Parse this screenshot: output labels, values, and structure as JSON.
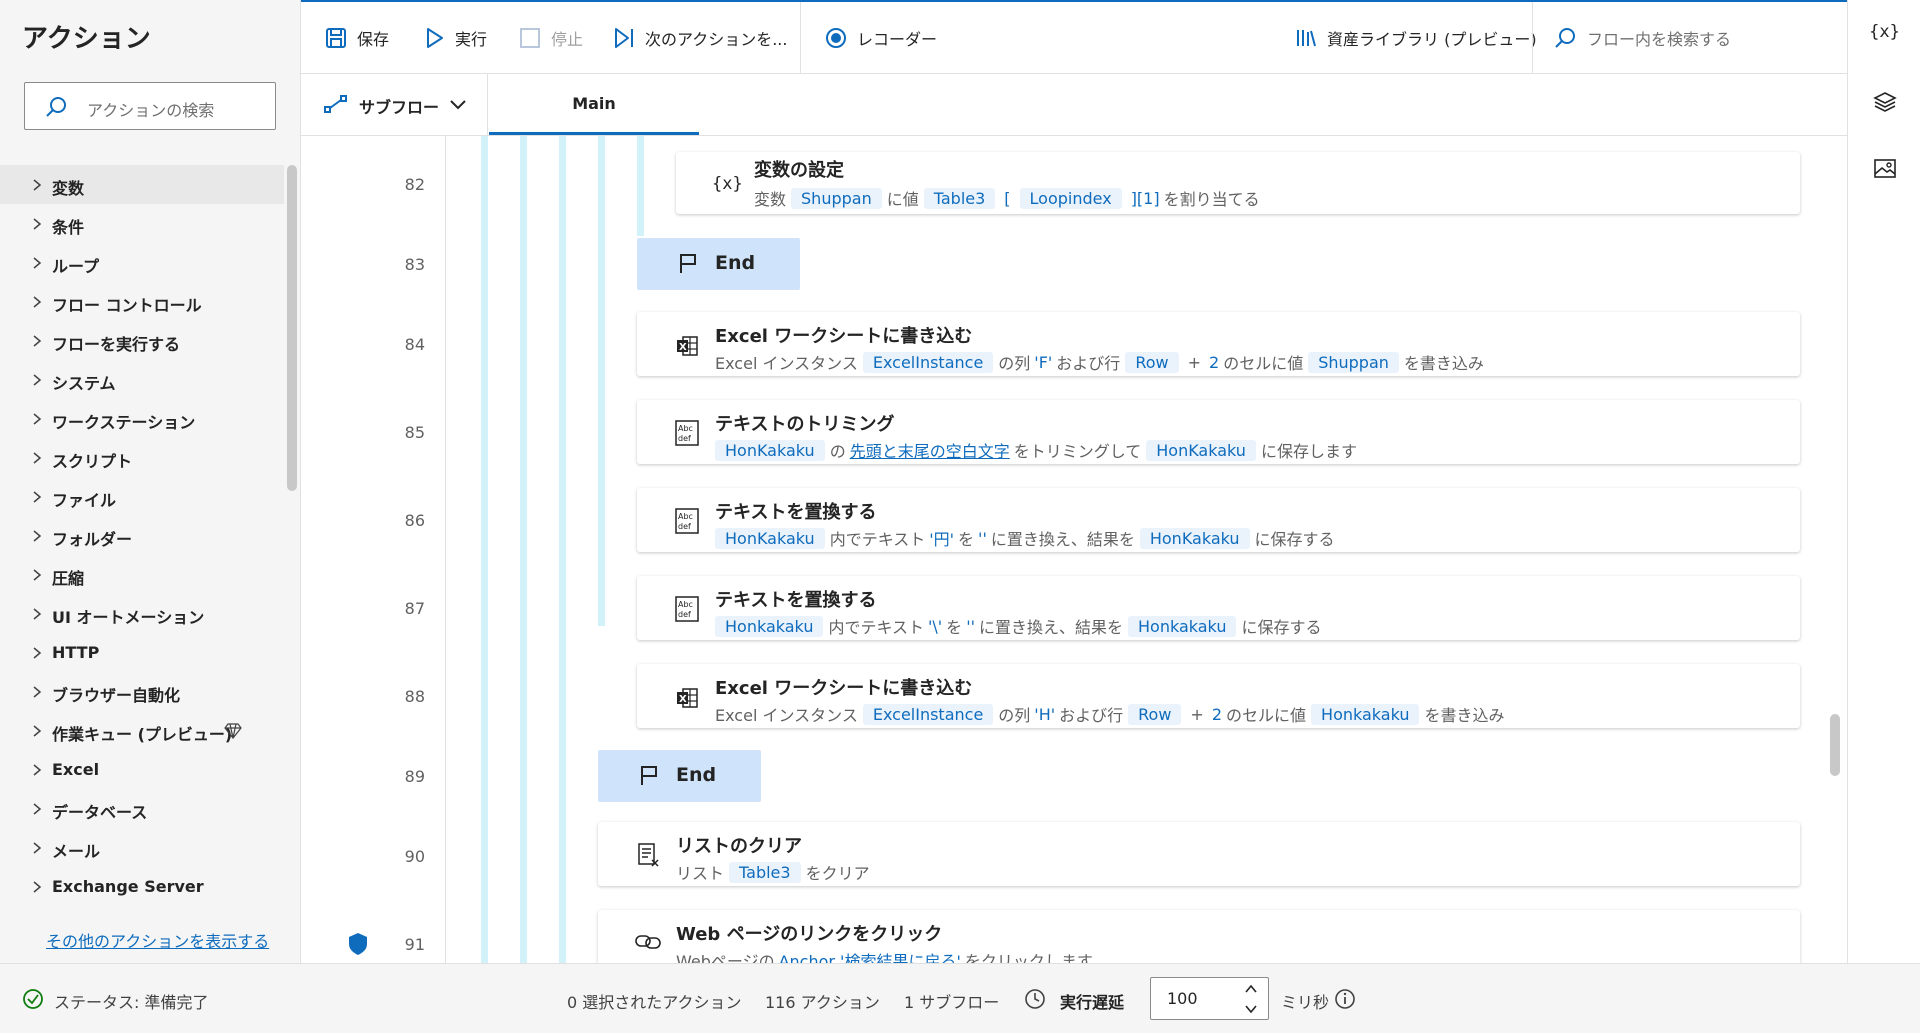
{
  "left_pane": {
    "title": "アクション",
    "search_placeholder": "アクションの検索",
    "categories": [
      {
        "label": "変数"
      },
      {
        "label": "条件"
      },
      {
        "label": "ループ"
      },
      {
        "label": "フロー コントロール"
      },
      {
        "label": "フローを実行する"
      },
      {
        "label": "システム"
      },
      {
        "label": "ワークステーション"
      },
      {
        "label": "スクリプト"
      },
      {
        "label": "ファイル"
      },
      {
        "label": "フォルダー"
      },
      {
        "label": "圧縮"
      },
      {
        "label": "UI オートメーション"
      },
      {
        "label": "HTTP"
      },
      {
        "label": "ブラウザー自動化"
      },
      {
        "label": "作業キュー (プレビュー)"
      },
      {
        "label": "Excel"
      },
      {
        "label": "データベース"
      },
      {
        "label": "メール"
      },
      {
        "label": "Exchange Server"
      }
    ],
    "more_actions": "その他のアクションを表示する"
  },
  "toolbar": {
    "save": "保存",
    "run": "実行",
    "stop": "停止",
    "next_action": "次のアクションを...",
    "recorder": "レコーダー",
    "asset_library": "資産ライブラリ (プレビュー)",
    "search_placeholder": "フロー内を検索する"
  },
  "tabs": {
    "subflow": "サブフロー",
    "main": "Main"
  },
  "flow": {
    "line_numbers": [
      "82",
      "83",
      "84",
      "85",
      "86",
      "87",
      "88",
      "89",
      "90",
      "91"
    ],
    "actions": {
      "a82": {
        "title": "変数の設定",
        "d1": "変数",
        "v1": "Shuppan",
        "d2": "に値",
        "v2": "Table3",
        "b1": "[",
        "v3": "Loopindex",
        "b2": "][1]",
        "d3": "を割り当てる"
      },
      "a83": {
        "title": "End"
      },
      "a84": {
        "title": "Excel ワークシートに書き込む",
        "d1": "Excel インスタンス",
        "v1": "ExcelInstance",
        "d2": "の列",
        "l1": "'F'",
        "d3": "および行",
        "v2": "Row",
        "d4": "+",
        "l2": "2",
        "d5": "のセルに値",
        "v3": "Shuppan",
        "d6": "を書き込み"
      },
      "a85": {
        "title": "テキストのトリミング",
        "v1": "HonKakaku",
        "d1": "の",
        "l1": "先頭と末尾の空白文字",
        "d2": "をトリミングして",
        "v2": "HonKakaku",
        "d3": "に保存します"
      },
      "a86": {
        "title": "テキストを置換する",
        "v1": "HonKakaku",
        "d1": "内でテキスト",
        "l1": "'円'",
        "d2": "を",
        "l2": "''",
        "d3": "に置き換え、結果を",
        "v2": "HonKakaku",
        "d4": "に保存する"
      },
      "a87": {
        "title": "テキストを置換する",
        "v1": "Honkakaku",
        "d1": "内でテキスト",
        "l1": "'\\'",
        "d2": "を",
        "l2": "''",
        "d3": "に置き換え、結果を",
        "v2": "Honkakaku",
        "d4": "に保存する"
      },
      "a88": {
        "title": "Excel ワークシートに書き込む",
        "d1": "Excel インスタンス",
        "v1": "ExcelInstance",
        "d2": "の列",
        "l1": "'H'",
        "d3": "および行",
        "v2": "Row",
        "d4": "+",
        "l2": "2",
        "d5": "のセルに値",
        "v3": "Honkakaku",
        "d6": "を書き込み"
      },
      "a89": {
        "title": "End"
      },
      "a90": {
        "title": "リストのクリア",
        "d1": "リスト",
        "v1": "Table3",
        "d2": "をクリア"
      },
      "a91": {
        "title": "Web ページのリンクをクリック",
        "d1": "Webページの",
        "l1": "Anchor '検索結果に戻る'",
        "d2": "をクリックします"
      }
    }
  },
  "status_bar": {
    "status": "ステータス: 準備完了",
    "selected": "0 選択されたアクション",
    "actions": "116 アクション",
    "subflows": "1 サブフロー",
    "delay_label": "実行遅延",
    "delay_value": "100",
    "unit": "ミリ秒"
  },
  "colors": {
    "accent": "#0f6cbd",
    "token_bg": "#eaf3fc",
    "nest_bar": "#d2f2fa",
    "end_block": "#cfe4fa",
    "status_ok": "#107c10"
  }
}
